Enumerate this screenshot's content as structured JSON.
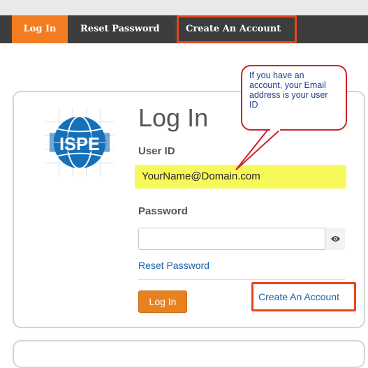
{
  "nav": {
    "tabs": [
      {
        "label": "Log In",
        "active": true
      },
      {
        "label": "Reset Password",
        "active": false
      },
      {
        "label": "Create An Account",
        "active": false
      }
    ]
  },
  "login": {
    "title": "Log In",
    "userid_label": "User ID",
    "userid_value": "YourName@Domain.com",
    "password_label": "Password",
    "password_value": "",
    "reset_link": "Reset Password",
    "login_button": "Log In",
    "create_link": "Create An Account"
  },
  "callout": {
    "text": "If you have an account, your Email address is your user ID"
  },
  "logo": {
    "text": "ISPE"
  },
  "icons": {
    "reveal_password": "eye-icon"
  },
  "colors": {
    "accent": "#f47c20",
    "highlight_box": "#e8451c",
    "callout_border": "#d2202a",
    "link": "#1a5fa8"
  }
}
